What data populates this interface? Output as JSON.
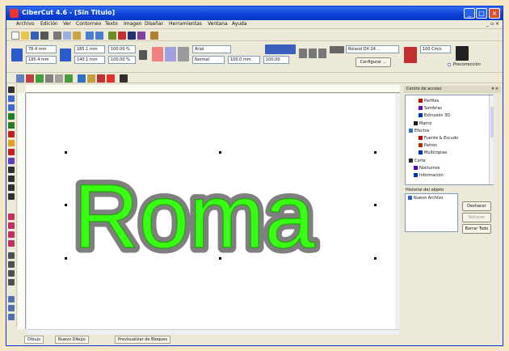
{
  "window": {
    "title": "CiberCut 4.6 - [Sin Titulo]",
    "controls": [
      "_",
      "□",
      "×"
    ]
  },
  "menu": {
    "items": [
      "Archivo",
      "Edición",
      "Ver",
      "Contorneo",
      "Texto",
      "Imagen",
      "Diseñar",
      "Herramientas",
      "Ventana",
      "Ayuda"
    ],
    "mdi_controls": "_ ▫ ×"
  },
  "toolbar2": {
    "pos_x": "78.4 mm",
    "pos_y": "195.4 mm",
    "size_w": "185.1 mm",
    "size_h": "140.1 mm",
    "scale_w": "100.00 %",
    "scale_h": "100.00 %",
    "font_name": "Arial",
    "font_style": "Normal",
    "font_size": "100.0 mm",
    "line_spacing": "100.00",
    "device": "Roland DX-24 ...",
    "configure_label": "Configurar ...",
    "output_label": "100 Cm/s",
    "checkbox_label": "Precorrección"
  },
  "text_object": {
    "text": "Roma",
    "fill_color": "#39ff14",
    "stroke_color": "#7f7f7f"
  },
  "panel": {
    "title": "Centro de acceso",
    "tree": [
      {
        "label": "Perfiles",
        "color": "#c00000"
      },
      {
        "label": "Sombras",
        "color": "#6a0dad"
      },
      {
        "label": "Extrusión 3D",
        "color": "#0033aa"
      },
      {
        "label": "Matriz",
        "color": "#1a1a1a"
      },
      {
        "label": "Efectos",
        "color": "#2a6cd6"
      },
      {
        "label": "Fuente & Escudo",
        "color": "#c00000"
      },
      {
        "label": "Patrón",
        "color": "#aa3300"
      },
      {
        "label": "Multicopias",
        "color": "#0033aa"
      },
      {
        "label": "Corte",
        "color": "#2a2a2a"
      },
      {
        "label": "Nocturnos",
        "color": "#5500aa"
      },
      {
        "label": "Información",
        "color": "#0033aa"
      }
    ],
    "history_title": "Historial del objeto",
    "history_item": "Nuevo Archivo",
    "history_buttons": [
      "Deshacer",
      "Rehacer",
      "Borrar Todo"
    ]
  },
  "tabs": [
    "Dibujo",
    "Nuevo Dibujo",
    "Previsualizar de Bloques"
  ]
}
